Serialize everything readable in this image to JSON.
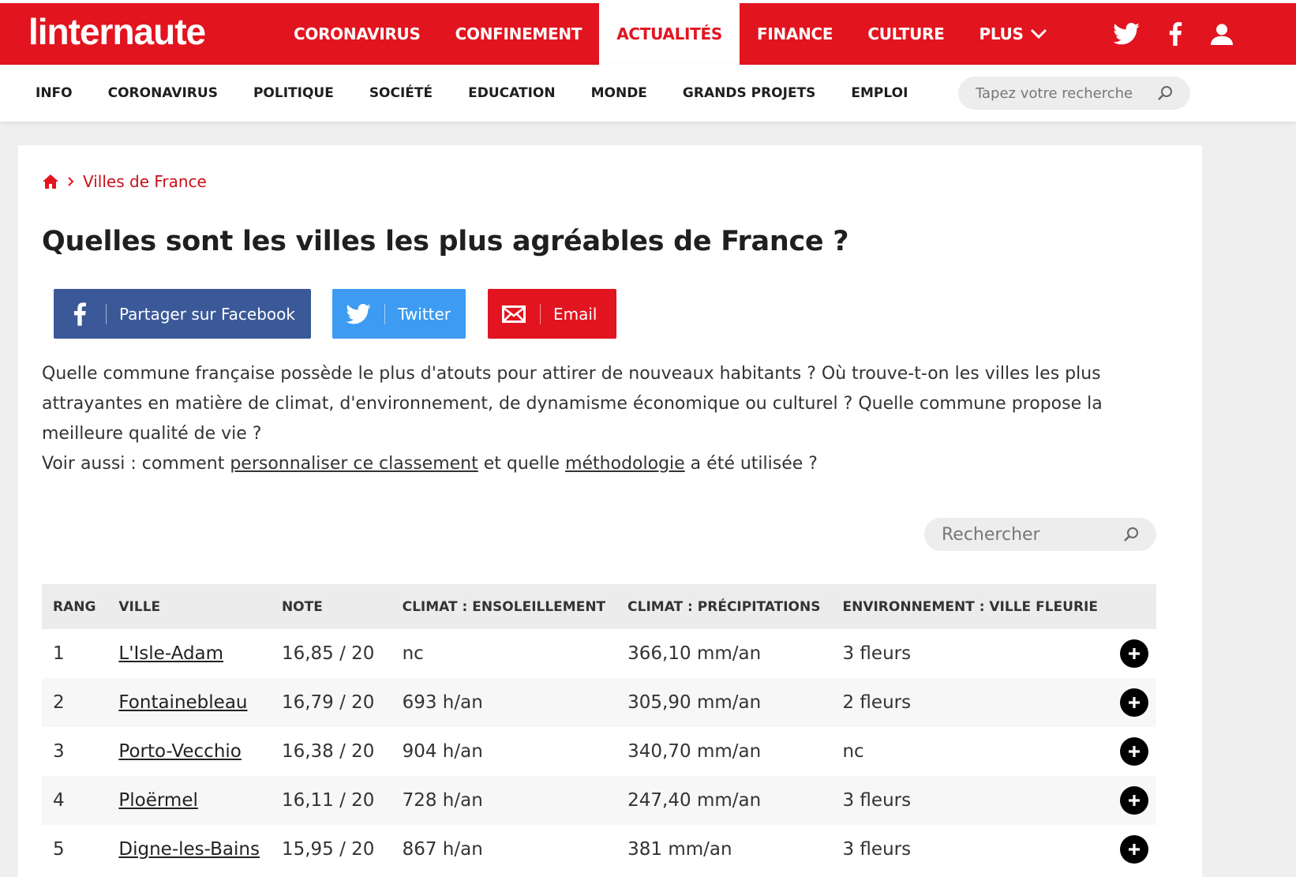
{
  "header": {
    "logo_text": "linternaute",
    "nav": [
      "CORONAVIRUS",
      "CONFINEMENT",
      "ACTUALITÉS",
      "FINANCE",
      "CULTURE",
      "PLUS"
    ],
    "active": "ACTUALITÉS",
    "icons": [
      "twitter-icon",
      "facebook-icon",
      "user-icon"
    ],
    "brand_color": "#e2141f"
  },
  "subnav": {
    "items": [
      "INFO",
      "CORONAVIRUS",
      "POLITIQUE",
      "SOCIÉTÉ",
      "EDUCATION",
      "MONDE",
      "GRANDS PROJETS",
      "EMPLOI"
    ],
    "search_placeholder": "Tapez votre recherche"
  },
  "breadcrumb": {
    "link": "Villes de France"
  },
  "page_title": "Quelles sont les villes les plus agréables de France ?",
  "share": {
    "facebook": "Partager sur Facebook",
    "twitter": "Twitter",
    "email": "Email",
    "colors": {
      "facebook": "#3b5998",
      "twitter": "#3d9bf2",
      "email": "#e2141f"
    }
  },
  "intro": {
    "paragraph": "Quelle commune française possède le plus d'atouts pour attirer de nouveaux habitants ? Où trouve-t-on les villes les plus attrayantes en matière de climat, d'environnement, de dynamisme économique ou culturel ? Quelle commune propose la meilleure qualité de vie ?",
    "see_also_prefix": "Voir aussi : comment ",
    "link1": "personnaliser ce classement",
    "middle": " et quelle ",
    "link2": "méthodologie",
    "suffix": " a été utilisée ?"
  },
  "table": {
    "search_placeholder": "Rechercher",
    "columns": [
      "RANG",
      "VILLE",
      "NOTE",
      "CLIMAT : ENSOLEILLEMENT",
      "CLIMAT : PRÉCIPITATIONS",
      "ENVIRONNEMENT : VILLE FLEURIE"
    ],
    "rows": [
      [
        "1",
        "L'Isle-Adam",
        "16,85 / 20",
        "nc",
        "366,10 mm/an",
        "3 fleurs"
      ],
      [
        "2",
        "Fontainebleau",
        "16,79 / 20",
        "693 h/an",
        "305,90 mm/an",
        "2 fleurs"
      ],
      [
        "3",
        "Porto-Vecchio",
        "16,38 / 20",
        "904 h/an",
        "340,70 mm/an",
        "nc"
      ],
      [
        "4",
        "Ploërmel",
        "16,11 / 20",
        "728 h/an",
        "247,40 mm/an",
        "3 fleurs"
      ],
      [
        "5",
        "Digne-les-Bains",
        "15,95 / 20",
        "867 h/an",
        "381 mm/an",
        "3 fleurs"
      ]
    ]
  }
}
